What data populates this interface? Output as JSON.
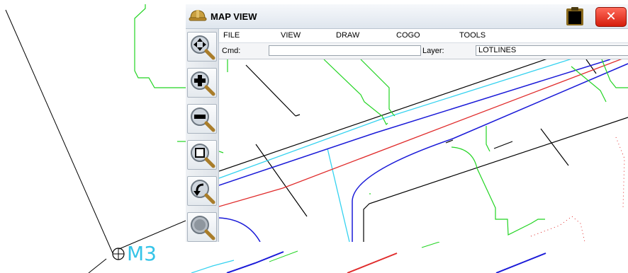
{
  "background": {
    "station_label": "M3",
    "label_color": "#34c4e8"
  },
  "window": {
    "title": "MAP VIEW",
    "close_glyph": "✕",
    "title_icon": "hardhat-icon",
    "clipboard_icon": "clipboard-icon",
    "colors": {
      "close": "#e0291a",
      "green": "#22d422",
      "blue": "#1a1ad8",
      "red": "#e02c2c",
      "cyan": "#34d2f0"
    }
  },
  "toolbar": {
    "tools": [
      {
        "name": "pan-zoom-tool",
        "icon": "pan-arrows-magnifier-icon"
      },
      {
        "name": "zoom-in-tool",
        "icon": "zoom-in-magnifier-icon"
      },
      {
        "name": "zoom-out-tool",
        "icon": "zoom-out-magnifier-icon"
      },
      {
        "name": "zoom-window-tool",
        "icon": "zoom-window-magnifier-icon"
      },
      {
        "name": "zoom-previous-tool",
        "icon": "zoom-previous-magnifier-icon"
      },
      {
        "name": "zoom-extents-tool",
        "icon": "zoom-extents-magnifier-icon"
      }
    ]
  },
  "menu": {
    "file": "FILE",
    "view": "VIEW",
    "draw": "DRAW",
    "cogo": "COGO",
    "tools": "TOOLS"
  },
  "command": {
    "label": "Cmd:",
    "value": "",
    "layer_label": "Layer:",
    "layer_value": "LOTLINES"
  }
}
